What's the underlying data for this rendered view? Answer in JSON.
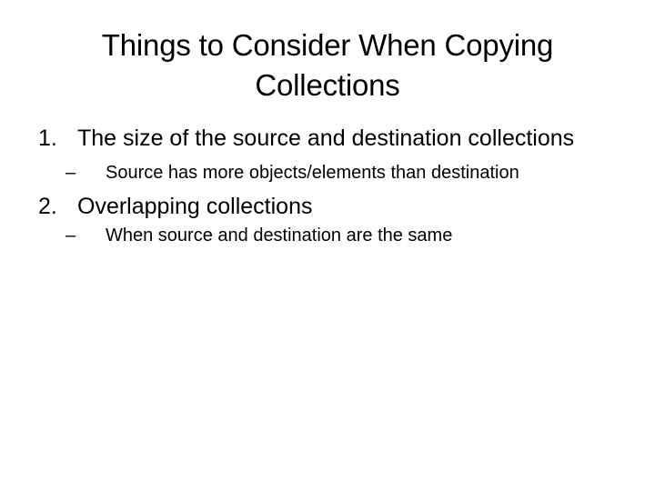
{
  "slide": {
    "title": "Things to Consider When Copying Collections",
    "items": [
      {
        "marker": "1.",
        "text": "The size of the source and destination collections",
        "subitems": [
          {
            "marker": "–",
            "text": "Source has more objects/elements than destination"
          }
        ]
      },
      {
        "marker": "2.",
        "text": "Overlapping collections",
        "subitems": [
          {
            "marker": "–",
            "text": "When source and destination are the same"
          }
        ]
      }
    ]
  }
}
